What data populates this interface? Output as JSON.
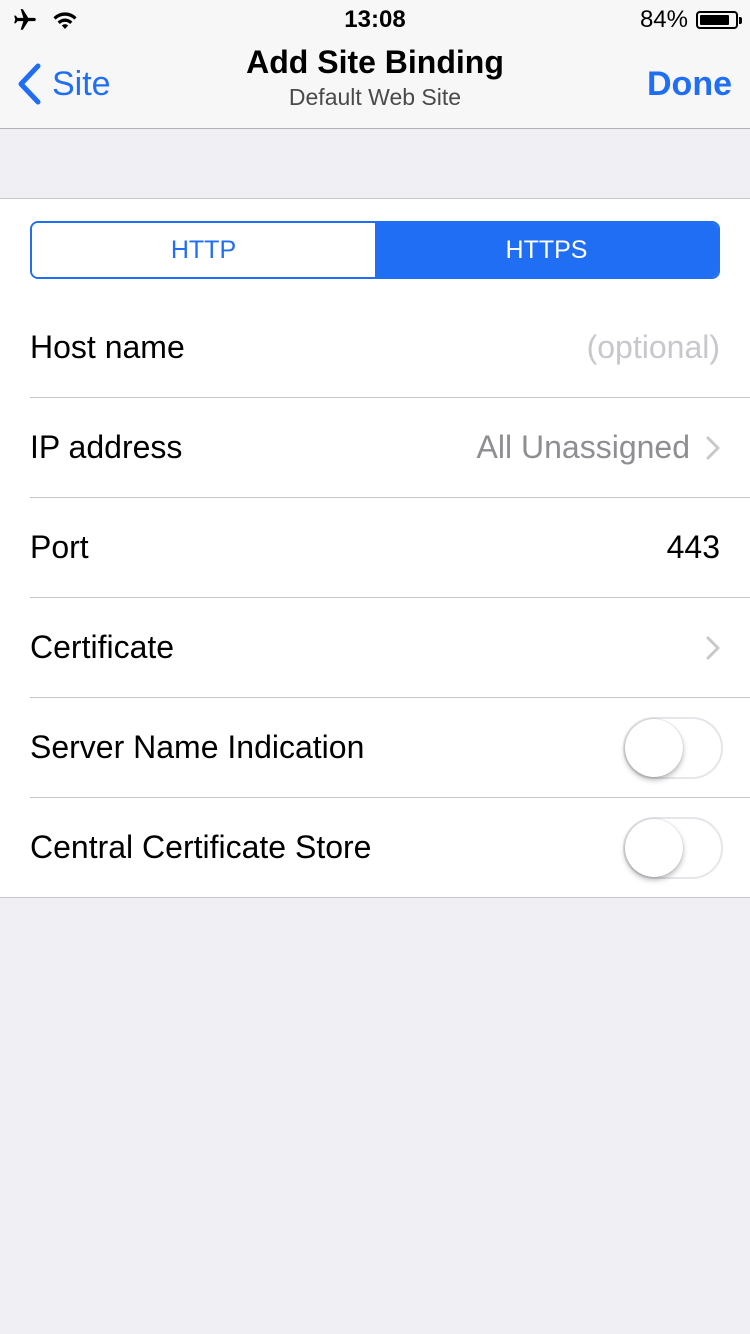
{
  "status_bar": {
    "time": "13:08",
    "battery_percent_label": "84%",
    "battery_level": 0.84,
    "icons": [
      "airplane-icon",
      "wifi-icon",
      "battery-icon"
    ]
  },
  "nav": {
    "back_label": "Site",
    "title": "Add Site Binding",
    "subtitle": "Default Web Site",
    "done_label": "Done"
  },
  "protocol": {
    "options": [
      "HTTP",
      "HTTPS"
    ],
    "selected": "HTTPS"
  },
  "fields": {
    "host_name": {
      "label": "Host name",
      "placeholder": "(optional)"
    },
    "ip_address": {
      "label": "IP address",
      "value": "All Unassigned"
    },
    "port": {
      "label": "Port",
      "value": "443"
    },
    "certificate": {
      "label": "Certificate"
    },
    "sni": {
      "label": "Server Name Indication",
      "enabled": false
    },
    "ccs": {
      "label": "Central Certificate Store",
      "enabled": false
    }
  },
  "colors": {
    "accent": "#1f6ef4",
    "background": "#efeff4",
    "separator": "#c8c7cc"
  }
}
